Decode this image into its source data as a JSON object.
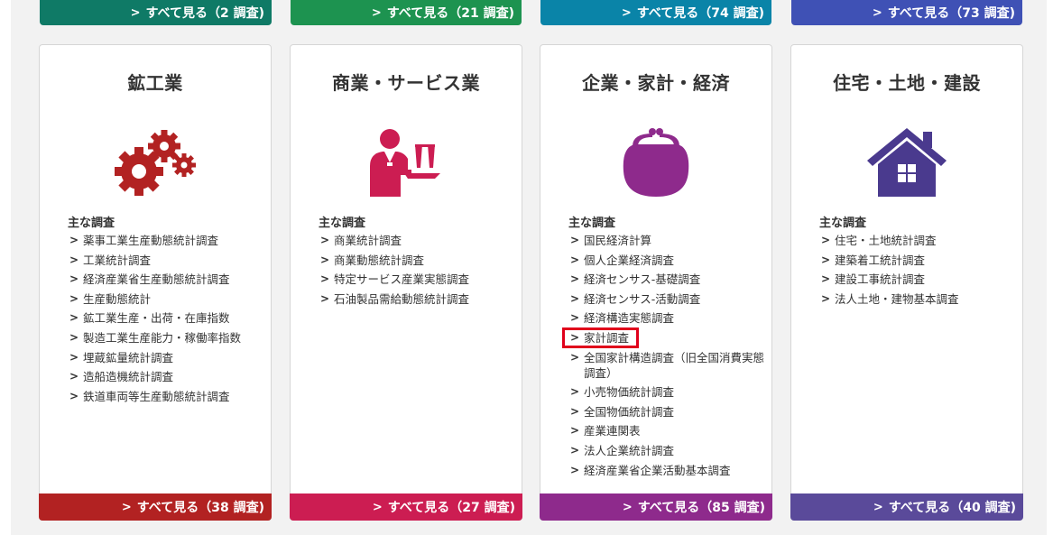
{
  "top_links": [
    {
      "label": "すべて見る（2 調査)",
      "color": "#0f7a66"
    },
    {
      "label": "すべて見る（21 調査)",
      "color": "#1d9350"
    },
    {
      "label": "すべて見る（74 調査)",
      "color": "#0a84a8"
    },
    {
      "label": "すべて見る（73 調査)",
      "color": "#3f51b5"
    }
  ],
  "cards": [
    {
      "title": "鉱工業",
      "icon": "gears-icon",
      "color": "#b22222",
      "heading": "主な調査",
      "items": [
        "薬事工業生産動態統計調査",
        "工業統計調査",
        "経済産業省生産動態統計調査",
        "生産動態統計",
        "鉱工業生産・出荷・在庫指数",
        "製造工業生産能力・稼働率指数",
        "埋蔵鉱量統計調査",
        "造船造機統計調査",
        "鉄道車両等生産動態統計調査"
      ],
      "footer": "すべて見る（38 調査)"
    },
    {
      "title": "商業・サービス業",
      "icon": "waiter-icon",
      "color": "#cc1d52",
      "heading": "主な調査",
      "items": [
        "商業統計調査",
        "商業動態統計調査",
        "特定サービス産業実態調査",
        "石油製品需給動態統計調査"
      ],
      "footer": "すべて見る（27 調査)"
    },
    {
      "title": "企業・家計・経済",
      "icon": "purse-icon",
      "color": "#8e2a8c",
      "heading": "主な調査",
      "items": [
        "国民経済計算",
        "個人企業経済調査",
        "経済センサス-基礎調査",
        "経済センサス-活動調査",
        "経済構造実態調査",
        "家計調査",
        "全国家計構造調査（旧全国消費実態調査）",
        "小売物価統計調査",
        "全国物価統計調査",
        "産業連関表",
        "法人企業統計調査",
        "経済産業省企業活動基本調査"
      ],
      "highlighted_item": "家計調査",
      "footer": "すべて見る（85 調査)"
    },
    {
      "title": "住宅・土地・建設",
      "icon": "house-icon",
      "color": "#5a4a9a",
      "heading": "主な調査",
      "items": [
        "住宅・土地統計調査",
        "建築着工統計調査",
        "建設工事統計調査",
        "法人土地・建物基本調査"
      ],
      "footer": "すべて見る（40 調査)"
    }
  ]
}
